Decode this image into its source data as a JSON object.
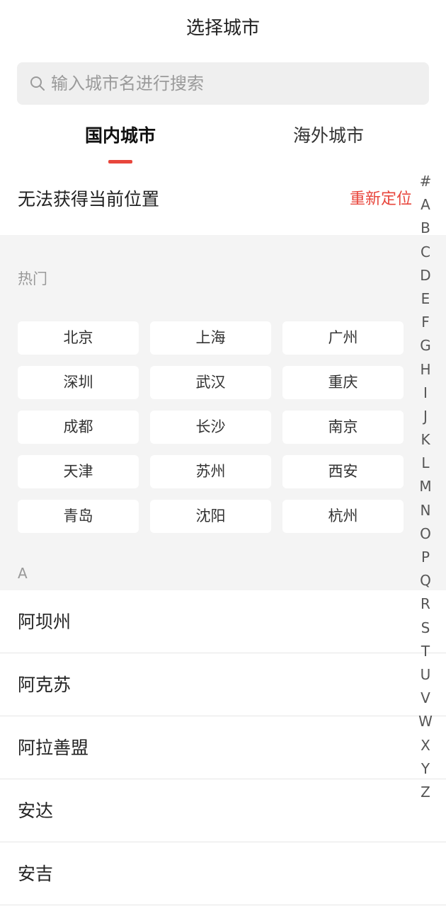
{
  "header": {
    "title": "选择城市"
  },
  "search": {
    "placeholder": "输入城市名进行搜索",
    "icon": "search-icon"
  },
  "tabs": [
    {
      "label": "国内城市",
      "active": true
    },
    {
      "label": "海外城市",
      "active": false
    }
  ],
  "location": {
    "status": "无法获得当前位置",
    "relocate_label": "重新定位"
  },
  "hot": {
    "title": "热门",
    "cities": [
      "北京",
      "上海",
      "广州",
      "深圳",
      "武汉",
      "重庆",
      "成都",
      "长沙",
      "南京",
      "天津",
      "苏州",
      "西安",
      "青岛",
      "沈阳",
      "杭州"
    ]
  },
  "list": {
    "section_letter": "A",
    "cities": [
      "阿坝州",
      "阿克苏",
      "阿拉善盟",
      "安达",
      "安吉"
    ]
  },
  "index_letters": [
    "#",
    "A",
    "B",
    "C",
    "D",
    "E",
    "F",
    "G",
    "H",
    "I",
    "J",
    "K",
    "L",
    "M",
    "N",
    "O",
    "P",
    "Q",
    "R",
    "S",
    "T",
    "U",
    "V",
    "W",
    "X",
    "Y",
    "Z"
  ],
  "colors": {
    "accent": "#e8463c",
    "section_bg": "#f4f4f4",
    "search_bg": "#efefef"
  }
}
